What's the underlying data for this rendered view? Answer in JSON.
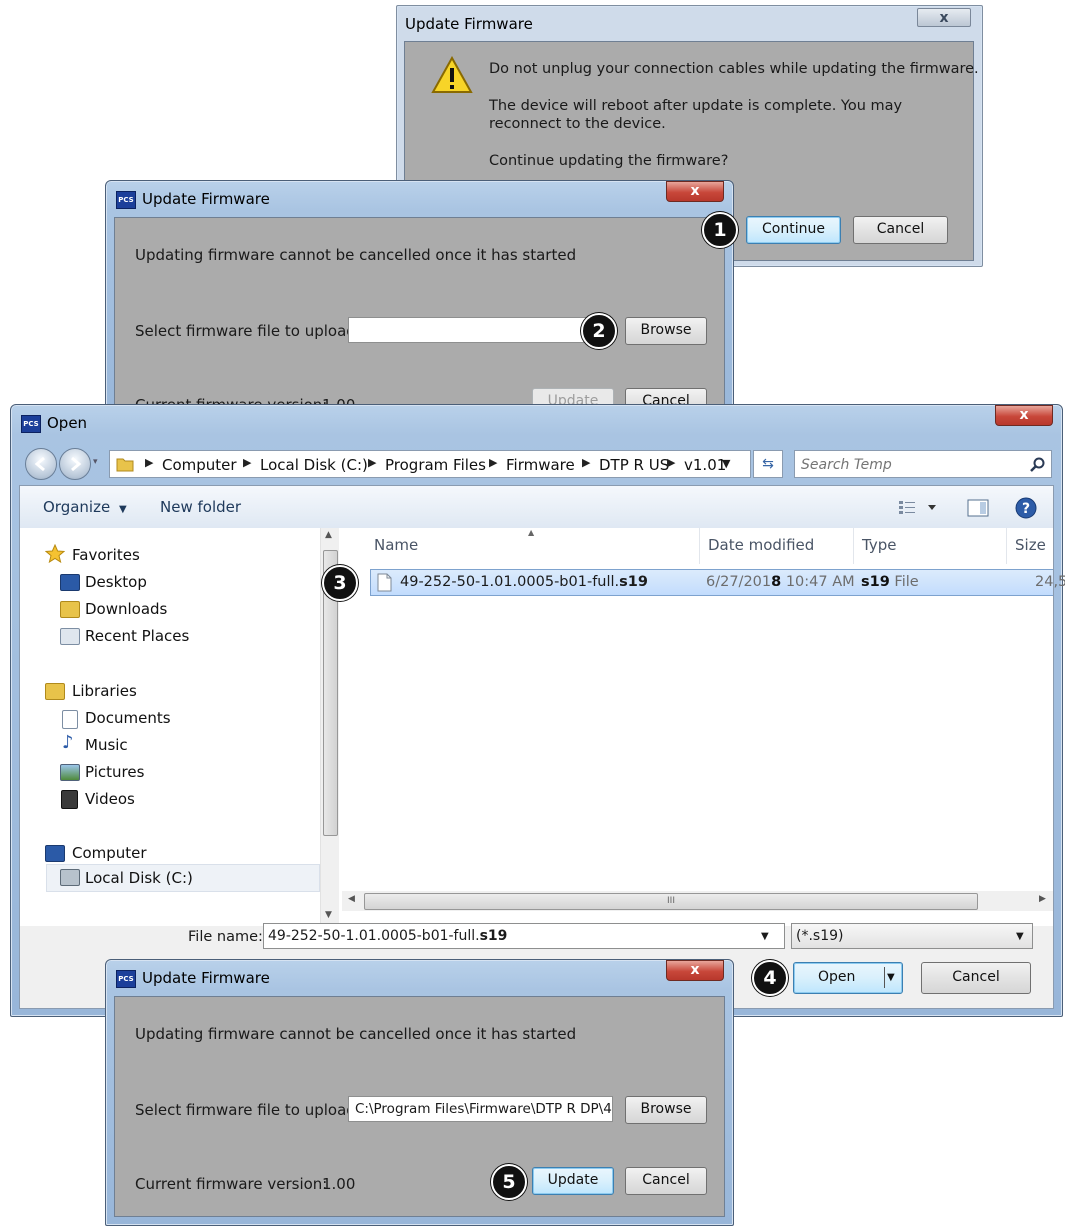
{
  "confirm_dialog": {
    "title": "Update Firmware",
    "close": "x",
    "line1": "Do not unplug your connection cables while updating the firmware.",
    "line2": "The device will reboot after update is complete. You may",
    "line3": "reconnect to the device.",
    "line4": "Continue updating the firmware?",
    "continue_label": "Continue",
    "cancel_label": "Cancel"
  },
  "update_dialog_top": {
    "title": "Update Firmware",
    "app_icon": "PCS",
    "close": "x",
    "notice": "Updating firmware cannot be cancelled once it has started",
    "select_label": "Select firmware file to upload:",
    "file_value": "",
    "browse_label": "Browse",
    "version_label": "Current firmware version:",
    "version_value": "1.00",
    "update_label": "Update",
    "cancel_label": "Cancel"
  },
  "open_dialog": {
    "title": "Open",
    "app_icon": "PCS",
    "close": "x",
    "breadcrumbs": [
      "Computer",
      "Local Disk (C:)",
      "Program Files",
      "Firmware",
      "DTP R US",
      "v1.01"
    ],
    "search_placeholder": "Search Temp",
    "toolbar": {
      "organize": "Organize",
      "new_folder": "New folder"
    },
    "nav": {
      "favorites": "Favorites",
      "favorites_items": [
        "Desktop",
        "Downloads",
        "Recent Places"
      ],
      "libraries": "Libraries",
      "libraries_items": [
        "Documents",
        "Music",
        "Pictures",
        "Videos"
      ],
      "computer": "Computer",
      "computer_items": [
        "Local Disk (C:)"
      ]
    },
    "columns": {
      "name": "Name",
      "date": "Date modified",
      "type": "Type",
      "size": "Size"
    },
    "file": {
      "name": "49-252-50-1.01.0005-b01-full.",
      "ext": "s19",
      "date_a": "6/27/201",
      "date_b": "8",
      "time": "10:47 AM",
      "type_a": "s19",
      "type_b": " File",
      "size": "24,5"
    },
    "filename_label": "File name:",
    "filename_value_a": "49-252-50-1.01.0005-b01-full.",
    "filename_value_b": "s19",
    "filter": "(*.s19)",
    "open_label": "Open",
    "cancel_label": "Cancel",
    "scroll_glyph": "III"
  },
  "update_dialog_bottom": {
    "title": "Update Firmware",
    "app_icon": "PCS",
    "close": "x",
    "notice": "Updating firmware cannot be cancelled once it has started",
    "select_label": "Select firmware file to upload:",
    "file_value": "C:\\Program Files\\Firmware\\DTP R DP\\4",
    "browse_label": "Browse",
    "version_label": "Current firmware version:",
    "version_value": "1.00",
    "update_label": "Update",
    "cancel_label": "Cancel"
  },
  "callouts": [
    "1",
    "2",
    "3",
    "4",
    "5"
  ],
  "colors": {
    "title_bar": "#a9c4e2",
    "client_gray": "#ababab",
    "close_red": "#c8473a",
    "selection": "#cce8ff"
  }
}
